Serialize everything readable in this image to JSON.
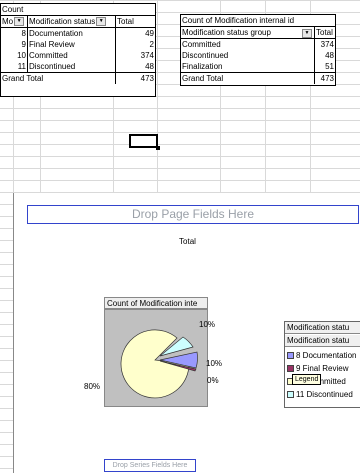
{
  "pivot1": {
    "title": "Count",
    "headers": {
      "col_a": "Mo",
      "col_b": "Modification status",
      "col_c": "Total"
    },
    "rows": [
      {
        "id": "8",
        "status": "Documentation",
        "total": "49"
      },
      {
        "id": "9",
        "status": "Final Review",
        "total": "2"
      },
      {
        "id": "10",
        "status": "Committed",
        "total": "374"
      },
      {
        "id": "11",
        "status": "Discontinued",
        "total": "48"
      }
    ],
    "grand_total_label": "Grand Total",
    "grand_total_value": "473"
  },
  "pivot2": {
    "title": "Count of Modification internal id",
    "headers": {
      "col_a": "Modification status group",
      "col_b": "Total"
    },
    "rows": [
      {
        "group": "Committed",
        "total": "374"
      },
      {
        "group": "Discontinued",
        "total": "48"
      },
      {
        "group": "Finalization",
        "total": "51"
      }
    ],
    "grand_total_label": "Grand Total",
    "grand_total_value": "473"
  },
  "chart": {
    "page_fields_zone": "Drop Page Fields Here",
    "series_fields_zone": "Drop Series Fields Here",
    "total_label": "Total",
    "data_field_button": "Count of Modification inte",
    "pct_labels": {
      "p80": "80%",
      "p10a": "10%",
      "p10b": "10%",
      "p0": "0%"
    },
    "legend_field_1": "Modification statu",
    "legend_field_2": "Modification statu",
    "legend_items": [
      {
        "label": "8 Documentation",
        "color": "#9999ff"
      },
      {
        "label": "9 Final Review",
        "color": "#993366"
      },
      {
        "label": "10 Committed",
        "color": "#ffffcc"
      },
      {
        "label": "11 Discontinued",
        "color": "#ccffff"
      }
    ],
    "legend_tooltip": "Legend"
  }
}
